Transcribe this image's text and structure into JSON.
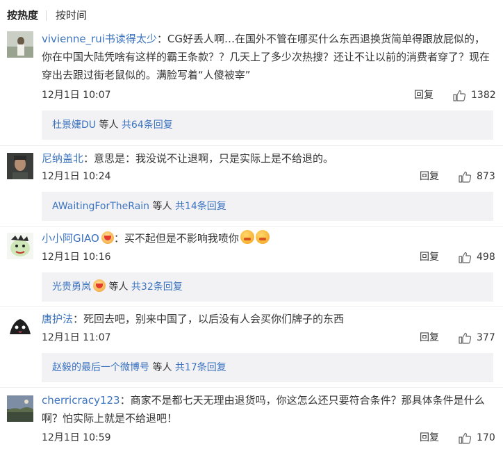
{
  "sort": {
    "hot_label": "按热度",
    "time_label": "按时间"
  },
  "comments": [
    {
      "user": "vivienne_rui书读得太少",
      "text": "CG好丢人啊…在国外不管在哪买什么东西退换货简单得跟放屁似的，你在中国大陆凭啥有这样的霸王条款？？几天上了多少次热搜？还让不让以前的消费者穿了？现在穿出去跟过街老鼠似的。满脸写着“人傻被宰”",
      "time": "12月1日 10:07",
      "reply_label": "回复",
      "likes": "1382",
      "sub_user": "杜景婕DU",
      "sub_wait": " 等人 ",
      "sub_count": "共64条回复"
    },
    {
      "user": "尼纳盖北",
      "text": "意思是：我没说不让退啊，只是实际上是不给退的。",
      "time": "12月1日 10:24",
      "reply_label": "回复",
      "likes": "873",
      "sub_user": "AWaitingForTheRain",
      "sub_wait": " 等人 ",
      "sub_count": "共14条回复"
    },
    {
      "user": "小小阿GIAO",
      "text": "买不起但是不影响我喷你",
      "time": "12月1日 10:16",
      "reply_label": "回复",
      "likes": "498",
      "sub_user": "光贵勇岚",
      "sub_wait": " 等人 ",
      "sub_count": "共32条回复"
    },
    {
      "user": "唐护法",
      "text": "死回去吧，别来中国了，以后没有人会买你们牌子的东西",
      "time": "12月1日 11:07",
      "reply_label": "回复",
      "likes": "377",
      "sub_user": "赵毅的最后一个微博号",
      "sub_wait": " 等人 ",
      "sub_count": "共17条回复"
    },
    {
      "user": "cherricracy123",
      "text": "商家不是都七天无理由退货吗，你这怎么还只要符合条件？那具体条件是什么啊？怕实际上就是不给退吧！",
      "time": "12月1日 10:59",
      "reply_label": "回复",
      "likes": "170"
    }
  ],
  "colors": {
    "username": "#3b73bf",
    "sub_bg": "#f2f2f5",
    "text": "#333333"
  },
  "icons": {
    "like": "thumbs-up-icon",
    "emoji": "angry-face-emoji-icon",
    "badge": "vip-badge-icon"
  }
}
